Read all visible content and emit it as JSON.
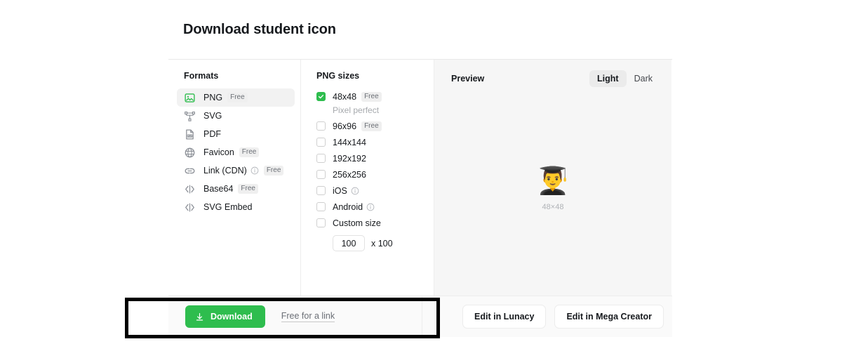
{
  "page_title": "Download student icon",
  "formats": {
    "heading": "Formats",
    "items": [
      {
        "label": "PNG",
        "icon": "image-icon",
        "badge": "Free",
        "info": false,
        "selected": true
      },
      {
        "label": "SVG",
        "icon": "svg-nodes-icon",
        "badge": "",
        "info": false,
        "selected": false
      },
      {
        "label": "PDF",
        "icon": "pdf-file-icon",
        "badge": "",
        "info": false,
        "selected": false
      },
      {
        "label": "Favicon",
        "icon": "globe-icon",
        "badge": "Free",
        "info": false,
        "selected": false
      },
      {
        "label": "Link (CDN)",
        "icon": "link-icon",
        "badge": "Free",
        "info": true,
        "selected": false
      },
      {
        "label": "Base64",
        "icon": "code-brackets-icon",
        "badge": "Free",
        "info": false,
        "selected": false
      },
      {
        "label": "SVG Embed",
        "icon": "code-brackets-icon",
        "badge": "",
        "info": false,
        "selected": false
      }
    ]
  },
  "sizes": {
    "heading": "PNG sizes",
    "items": [
      {
        "label": "48x48",
        "badge": "Free",
        "checked": true,
        "info": false,
        "sublabel": "Pixel perfect"
      },
      {
        "label": "96x96",
        "badge": "Free",
        "checked": false,
        "info": false,
        "sublabel": ""
      },
      {
        "label": "144x144",
        "badge": "",
        "checked": false,
        "info": false,
        "sublabel": ""
      },
      {
        "label": "192x192",
        "badge": "",
        "checked": false,
        "info": false,
        "sublabel": ""
      },
      {
        "label": "256x256",
        "badge": "",
        "checked": false,
        "info": false,
        "sublabel": ""
      },
      {
        "label": "iOS",
        "badge": "",
        "checked": false,
        "info": true,
        "sublabel": ""
      },
      {
        "label": "Android",
        "badge": "",
        "checked": false,
        "info": true,
        "sublabel": ""
      },
      {
        "label": "Custom size",
        "badge": "",
        "checked": false,
        "info": false,
        "sublabel": ""
      }
    ],
    "custom": {
      "value": "100",
      "placeholder": "100",
      "suffix": "x 100"
    }
  },
  "preview": {
    "heading": "Preview",
    "theme_light": "Light",
    "theme_dark": "Dark",
    "active_theme": "Light",
    "icon_glyph": "👨‍🎓",
    "size_caption": "48×48"
  },
  "footer": {
    "download_label": "Download",
    "free_link_label": "Free for a link",
    "edit_lunacy_label": "Edit in Lunacy",
    "edit_mega_label": "Edit in Mega Creator"
  },
  "colors": {
    "accent_green": "#2ebd4e",
    "panel_bg": "#f6f6f6",
    "footer_bg": "#fafafa",
    "text": "#16191d",
    "muted": "#6b6f76",
    "annotation": "#000000"
  }
}
